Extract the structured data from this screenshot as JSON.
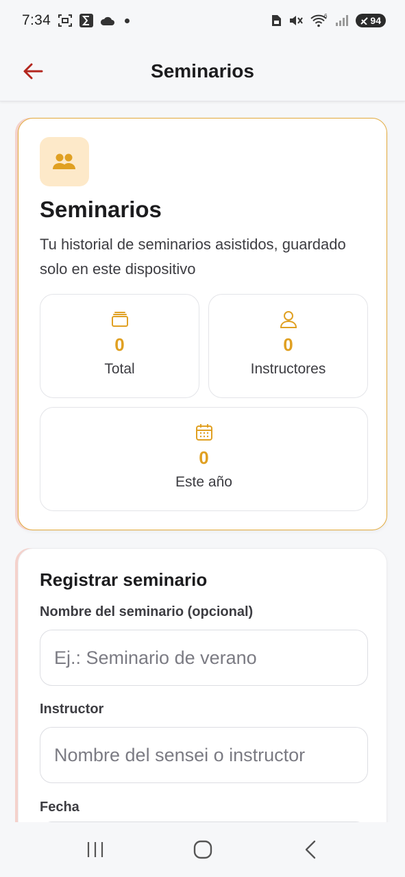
{
  "status_bar": {
    "time": "7:34",
    "battery": "94",
    "icons": [
      "screenshot-icon",
      "sigma-icon",
      "cloud-icon",
      "notification-dot",
      "sim-icon",
      "mute-icon",
      "wifi-icon",
      "signal-icon",
      "battery-icon"
    ]
  },
  "app_bar": {
    "title": "Seminarios",
    "back_icon": "arrow-left-icon",
    "accent": "#b3261e"
  },
  "hero": {
    "icon": "group-icon",
    "title": "Seminarios",
    "subtitle": "Tu historial de seminarios asistidos, guardado solo en este dispositivo",
    "stats": {
      "total": {
        "icon": "stack-icon",
        "value": "0",
        "label": "Total"
      },
      "instructors": {
        "icon": "person-icon",
        "value": "0",
        "label": "Instructores"
      },
      "year": {
        "icon": "calendar-icon",
        "value": "0",
        "label": "Este año"
      }
    },
    "accent": "#e0a022"
  },
  "form": {
    "title": "Registrar seminario",
    "name_label": "Nombre del seminario (opcional)",
    "name_placeholder": "Ej.: Seminario de verano",
    "instructor_label": "Instructor",
    "instructor_placeholder": "Nombre del sensei o instructor",
    "date_label": "Fecha"
  },
  "nav_bar": {
    "icons": [
      "recent-apps-icon",
      "home-icon",
      "back-icon"
    ]
  }
}
